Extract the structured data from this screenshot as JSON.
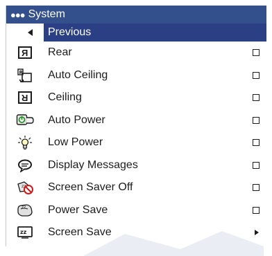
{
  "menu": {
    "title": "System",
    "title_dots": "●●●",
    "previous_label": "Previous",
    "items": [
      {
        "label": "Rear",
        "icon": "rear-projection-icon",
        "control": "checkbox",
        "checked": false
      },
      {
        "label": "Auto Ceiling",
        "icon": "auto-ceiling-icon",
        "control": "checkbox",
        "checked": false
      },
      {
        "label": "Ceiling",
        "icon": "ceiling-icon",
        "control": "checkbox",
        "checked": false
      },
      {
        "label": "Auto Power",
        "icon": "auto-power-icon",
        "control": "checkbox",
        "checked": false
      },
      {
        "label": "Low Power",
        "icon": "lamp-icon",
        "control": "checkbox",
        "checked": false
      },
      {
        "label": "Display Messages",
        "icon": "speech-bubble-icon",
        "control": "checkbox",
        "checked": false
      },
      {
        "label": "Screen Saver Off",
        "icon": "screen-saver-off-icon",
        "control": "checkbox",
        "checked": false
      },
      {
        "label": "Power Save",
        "icon": "power-save-icon",
        "control": "checkbox",
        "checked": false
      },
      {
        "label": "Screen Save",
        "icon": "screen-save-icon",
        "control": "submenu"
      }
    ]
  },
  "colors": {
    "title_bar": "#34508c",
    "selected_row": "#2b3f85",
    "text": "#1c1c1c",
    "background": "#ffffff"
  }
}
